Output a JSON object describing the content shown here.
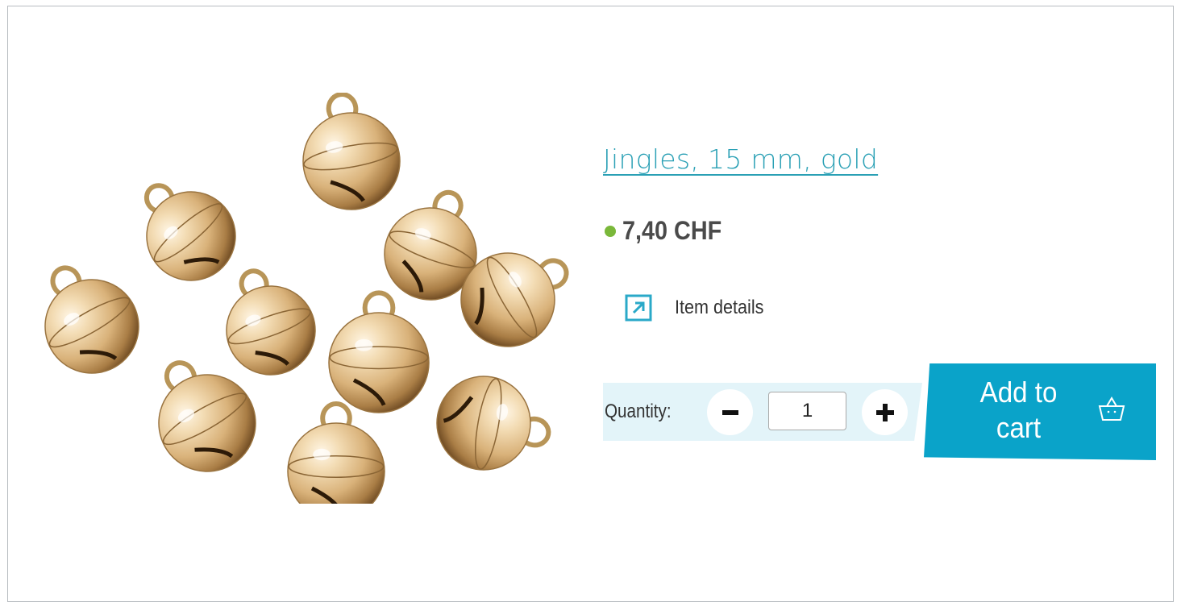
{
  "product": {
    "title": "Jingles, 15 mm, gold",
    "price": "7,40 CHF",
    "stock_color": "#7ab83a"
  },
  "details_link": {
    "label": "Item details",
    "icon": "external-link-icon"
  },
  "quantity": {
    "label": "Quantity:",
    "value": "1",
    "minus_icon": "minus-icon",
    "plus_icon": "plus-icon"
  },
  "cart": {
    "label_line1": "Add to",
    "label_line2": "cart",
    "icon": "basket-icon"
  },
  "colors": {
    "accent": "#2aa0b5",
    "button": "#0aa3c9",
    "quantity_bg": "#e3f4f9"
  }
}
